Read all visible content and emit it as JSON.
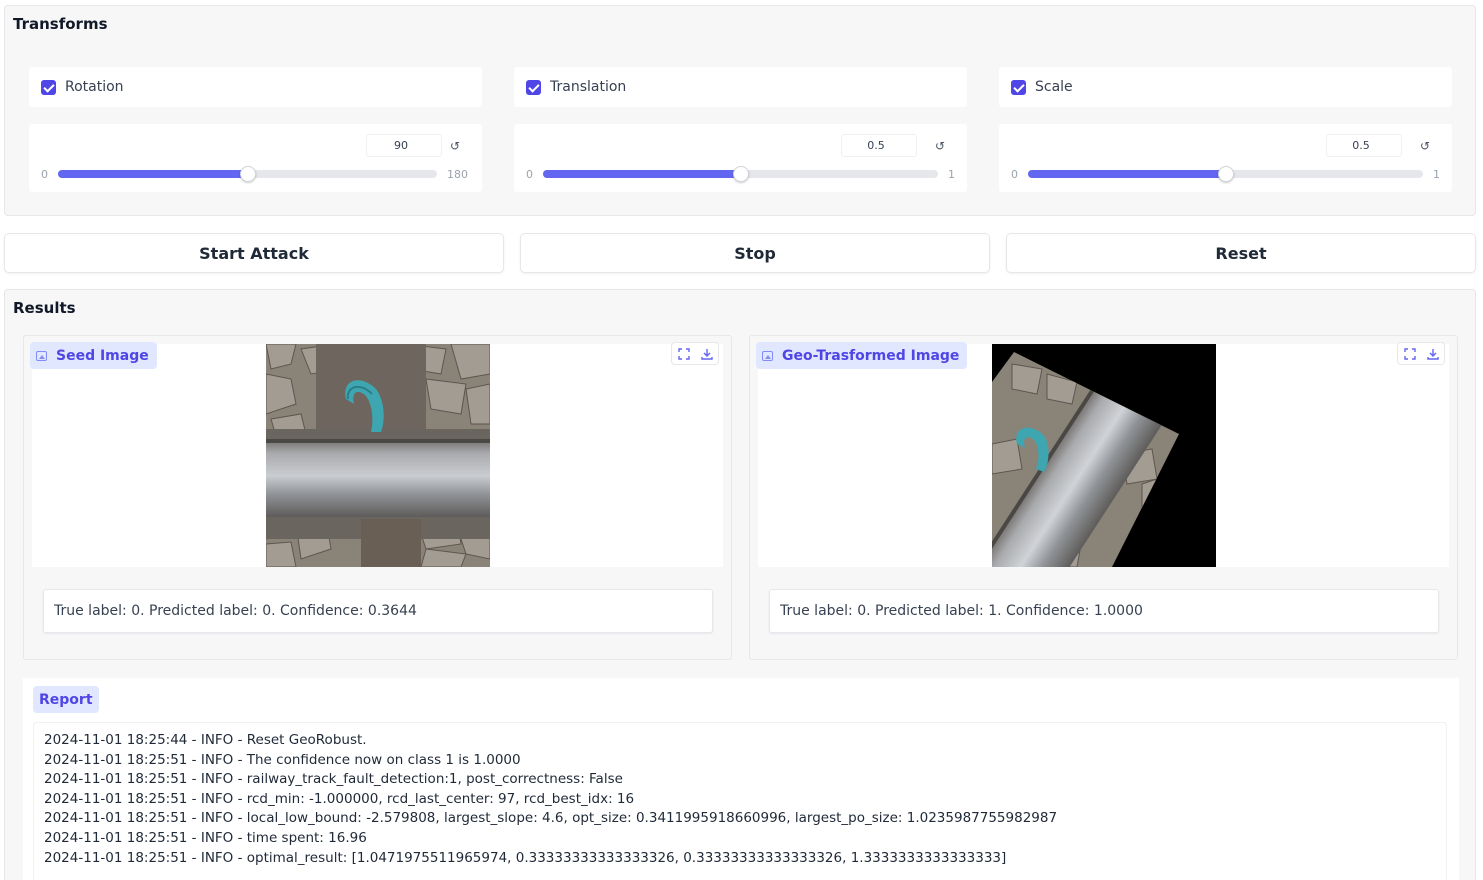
{
  "transforms": {
    "title": "Transforms",
    "controls": [
      {
        "label": "Rotation",
        "checked": true,
        "value": "90",
        "min": "0",
        "max": "180",
        "fraction": 0.5
      },
      {
        "label": "Translation",
        "checked": true,
        "value": "0.5",
        "min": "0",
        "max": "1",
        "fraction": 0.5
      },
      {
        "label": "Scale",
        "checked": true,
        "value": "0.5",
        "min": "0",
        "max": "1",
        "fraction": 0.5
      }
    ],
    "reset_icon": "↺"
  },
  "buttons": {
    "start": "Start Attack",
    "stop": "Stop",
    "reset": "Reset"
  },
  "results": {
    "title": "Results",
    "seed": {
      "label": "Seed Image",
      "caption": "True label: 0. Predicted label: 0. Confidence: 0.3644"
    },
    "geo": {
      "label": "Geo-Trasformed Image",
      "caption": "True label: 0. Predicted label: 1. Confidence: 1.0000"
    },
    "report": {
      "label": "Report",
      "lines": [
        "2024-11-01 18:25:44 - INFO - Reset GeoRobust.",
        "2024-11-01 18:25:51 - INFO - The confidence now on class 1 is 1.0000",
        "2024-11-01 18:25:51 - INFO - railway_track_fault_detection:1, post_correctness: False",
        "2024-11-01 18:25:51 - INFO - rcd_min: -1.000000, rcd_last_center: 97, rcd_best_idx: 16",
        "2024-11-01 18:25:51 - INFO - local_low_bound: -2.579808, largest_slope: 4.6, opt_size: 0.3411995918660996, largest_po_size: 1.0235987755982987",
        "2024-11-01 18:25:51 - INFO - time spent: 16.96",
        "2024-11-01 18:25:51 - INFO - optimal_result: [1.0471975511965974, 0.33333333333333326, 0.33333333333333326, 1.3333333333333333]"
      ]
    }
  },
  "colors": {
    "accent": "#6366f1",
    "checkbox": "#4f46e5",
    "label_bg": "#e0e7ff"
  },
  "icons": [
    "image-icon",
    "fullscreen-icon",
    "download-icon",
    "reset-icon",
    "checkbox-checked-icon"
  ]
}
